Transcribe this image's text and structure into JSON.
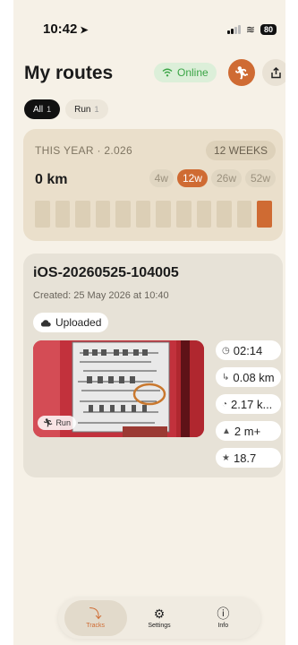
{
  "status_bar": {
    "time": "10:42",
    "battery": "80"
  },
  "header": {
    "title": "My routes",
    "online_label": "Online"
  },
  "filters": [
    {
      "label": "All",
      "count": "1",
      "active": true
    },
    {
      "label": "Run",
      "count": "1",
      "active": false
    }
  ],
  "year_summary": {
    "label": "THIS YEAR · 2.026",
    "weeks_badge": "12 WEEKS",
    "distance": "0 km",
    "ranges": [
      "4w",
      "12w",
      "26w",
      "52w"
    ],
    "selected_range": "12w",
    "weekly_km": [
      0,
      0,
      0,
      0,
      0,
      0,
      0,
      0,
      0,
      0,
      0,
      0.08
    ]
  },
  "route": {
    "name": "iOS-20260525-104005",
    "created": "Created: 25 May 2026 at 10:40",
    "upload_status": "Uploaded",
    "activity": "Run",
    "stats": [
      {
        "icon": "clock-icon",
        "value": "02:14"
      },
      {
        "icon": "route-icon",
        "value": "0.08 km"
      },
      {
        "icon": "pace-icon",
        "value": "2.17 k..."
      },
      {
        "icon": "elevation-icon",
        "value": "2 m+"
      },
      {
        "icon": "star-icon",
        "value": "18.7"
      }
    ]
  },
  "tabbar": [
    {
      "label": "Tracks",
      "icon": "tracks-icon",
      "active": true
    },
    {
      "label": "Settings",
      "icon": "gear-icon",
      "active": false
    },
    {
      "label": "Info",
      "icon": "info-icon",
      "active": false
    }
  ],
  "colors": {
    "accent": "#cf6b33",
    "online": "#3ba546",
    "background": "#f6f1e7"
  }
}
